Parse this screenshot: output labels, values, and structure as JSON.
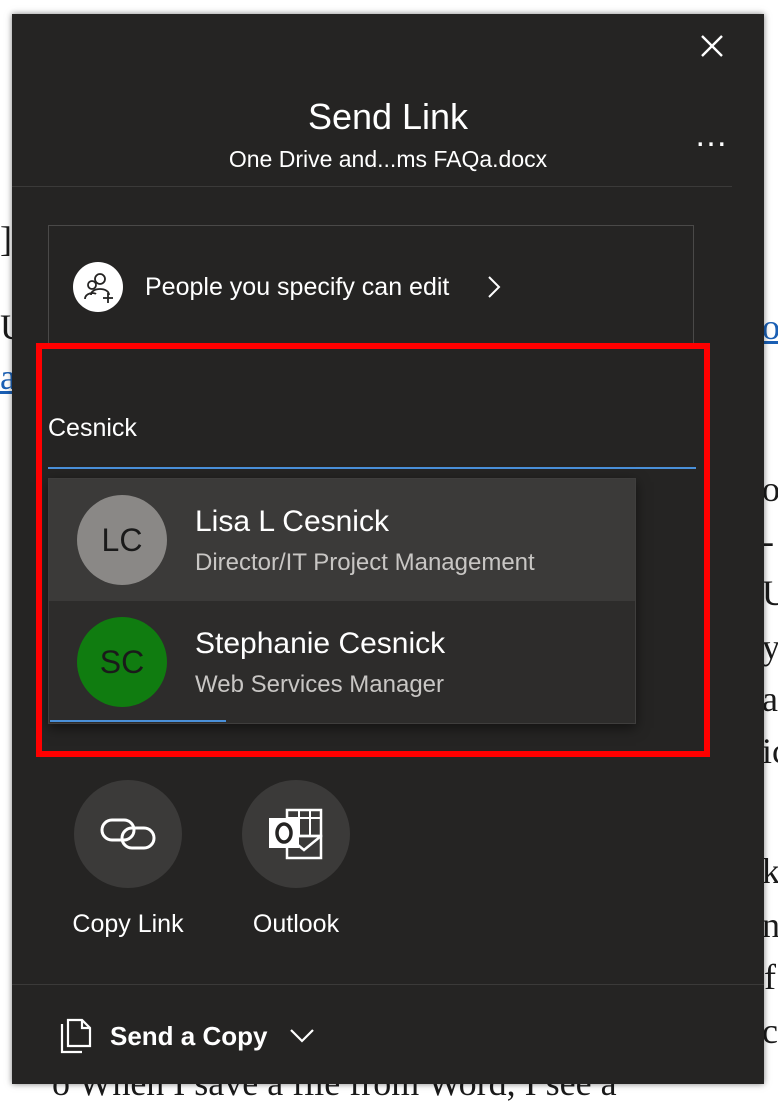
{
  "background": {
    "fragments": [
      "]",
      "U",
      "a",
      "o",
      "or",
      "-",
      "U",
      "y",
      "a",
      "ic",
      "k",
      "ne",
      "f",
      "c"
    ],
    "bottom_line": "o    When I save a file from Word, I see a"
  },
  "dialog": {
    "title": "Send Link",
    "filename": "One Drive and...ms FAQa.docx",
    "more_label": "…",
    "permission": {
      "label": "People you specify can edit"
    },
    "search": {
      "value": "Cesnick"
    },
    "suggestions": [
      {
        "initials": "LC",
        "name": "Lisa L Cesnick",
        "title": "Director/IT Project Management",
        "color": "#8a8886"
      },
      {
        "initials": "SC",
        "name": "Stephanie Cesnick",
        "title": "Web Services Manager",
        "color": "#107c10"
      }
    ],
    "share_apps": [
      {
        "label": "Copy Link",
        "icon": "link-icon"
      },
      {
        "label": "Outlook",
        "icon": "outlook-icon"
      }
    ],
    "send_copy": {
      "label": "Send a Copy"
    }
  },
  "colors": {
    "dialog_bg": "#252423",
    "accent": "#4a90d9",
    "highlight": "#ff0000"
  }
}
